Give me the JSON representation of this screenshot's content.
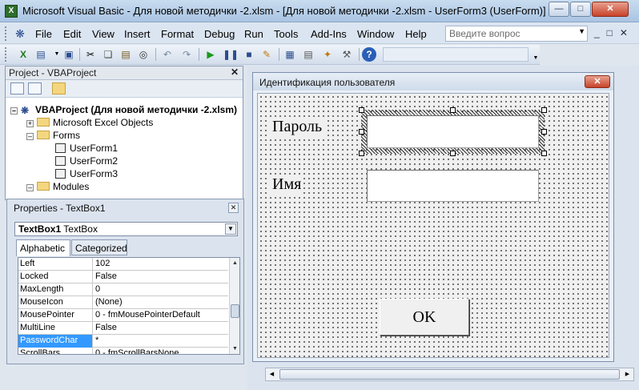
{
  "window": {
    "title": "Microsoft Visual Basic - Для новой методички -2.xlsm - [Для новой методички -2.xlsm - UserForm3 (UserForm)]",
    "app_icon": "excel-icon"
  },
  "menu": {
    "items": [
      "File",
      "Edit",
      "View",
      "Insert",
      "Format",
      "Debug",
      "Run",
      "Tools",
      "Add-Ins",
      "Window",
      "Help"
    ],
    "ask_placeholder": "Введите вопрос"
  },
  "toolbar": {
    "icons": [
      "excel-view-icon",
      "insert-userform-icon",
      "save-icon",
      "cut-icon",
      "copy-icon",
      "paste-icon",
      "find-icon",
      "undo-icon",
      "redo-icon",
      "run-icon",
      "break-icon",
      "reset-icon",
      "design-mode-icon",
      "project-explorer-icon",
      "properties-window-icon",
      "object-browser-icon",
      "toolbox-icon",
      "help-icon"
    ]
  },
  "project": {
    "title": "Project - VBAProject",
    "root": "VBAProject (Для новой методички -2.xlsm)",
    "nodes": [
      {
        "label": "Microsoft Excel Objects",
        "type": "folder"
      },
      {
        "label": "Forms",
        "type": "folder"
      },
      {
        "label": "UserForm1",
        "type": "form"
      },
      {
        "label": "UserForm2",
        "type": "form"
      },
      {
        "label": "UserForm3",
        "type": "form"
      },
      {
        "label": "Modules",
        "type": "folder"
      }
    ]
  },
  "properties": {
    "title": "Properties - TextBox1",
    "object_name": "TextBox1",
    "object_type": "TextBox",
    "tabs": [
      "Alphabetic",
      "Categorized"
    ],
    "rows": [
      {
        "name": "Left",
        "value": "102"
      },
      {
        "name": "Locked",
        "value": "False"
      },
      {
        "name": "MaxLength",
        "value": "0"
      },
      {
        "name": "MouseIcon",
        "value": "(None)"
      },
      {
        "name": "MousePointer",
        "value": "0 - fmMousePointerDefault"
      },
      {
        "name": "MultiLine",
        "value": "False"
      },
      {
        "name": "PasswordChar",
        "value": "*"
      },
      {
        "name": "ScrollBars",
        "value": "0 - fmScrollBarsNone"
      }
    ],
    "selected_row": "PasswordChar"
  },
  "form": {
    "caption": "Идентификация пользователя",
    "label_password": "Пароль",
    "label_name": "Имя",
    "ok_label": "OK",
    "close_glyph": "✕"
  },
  "colors": {
    "selection": "#3399ff",
    "close_button": "#c7432a"
  }
}
